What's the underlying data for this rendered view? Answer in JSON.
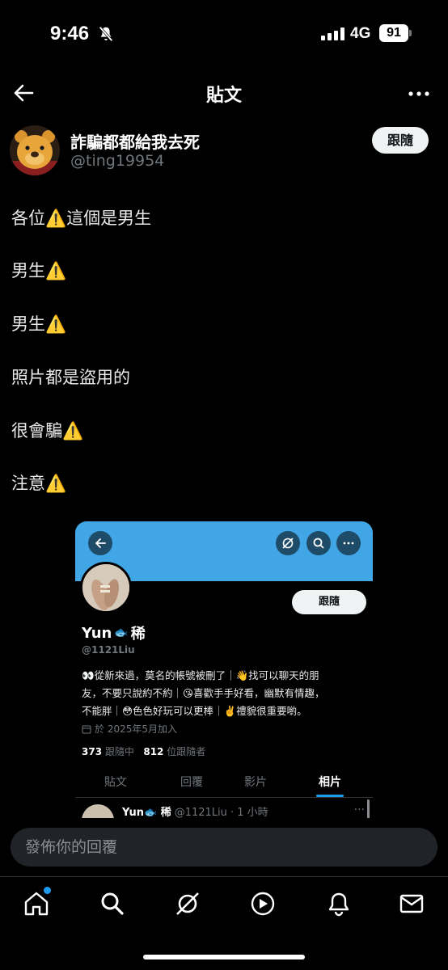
{
  "status": {
    "time": "9:46",
    "network": "4G",
    "battery": "91"
  },
  "nav": {
    "title": "貼文"
  },
  "author": {
    "display_name": "詐騙都都給我去死",
    "handle": "@ting19954",
    "follow_label": "跟隨"
  },
  "post_lines": [
    "各位⚠️這個是男生",
    "男生⚠️",
    "男生⚠️",
    "照片都是盜用的",
    "很會騙⚠️",
    "注意⚠️"
  ],
  "embed": {
    "name_prefix": "Yun",
    "name_emoji": "🐟",
    "name_suffix": "稀",
    "handle": "@1121Liu",
    "follow_label": "跟隨",
    "bio_lines": [
      "👀從新來過，莫名的帳號被刪了｜👋找可以聊天的朋",
      "友，不要只說約不約｜😘喜歡手手好看，幽默有情趣，",
      "不能胖｜😳色色好玩可以更棒｜✌️禮貌很重要喲。"
    ],
    "joined": "於 2025年5月加入",
    "following_count": "373",
    "following_label": "跟隨中",
    "followers_count": "812",
    "followers_label": "位跟隨者",
    "tabs": [
      "貼文",
      "回覆",
      "影片",
      "相片"
    ],
    "active_tab": "相片",
    "post_preview": {
      "name": "Yun🐟 稀",
      "handle_time": "@1121Liu · 1 小時"
    }
  },
  "reply": {
    "placeholder": "發佈你的回覆"
  },
  "colors": {
    "accent": "#1d9bf0",
    "banner": "#41a6e6",
    "background": "#000000",
    "muted": "#71767b"
  },
  "tabbar_icons": [
    "home-icon",
    "search-icon",
    "grok-icon",
    "video-icon",
    "notifications-icon",
    "messages-icon"
  ]
}
